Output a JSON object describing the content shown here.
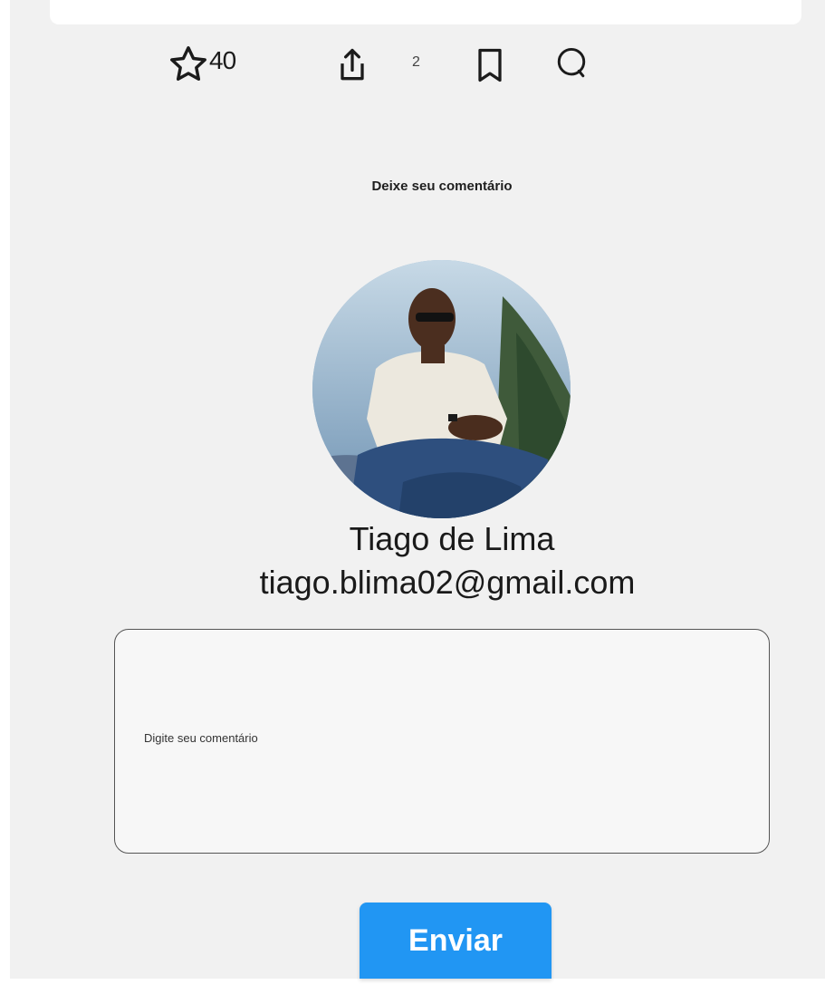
{
  "post_actions": {
    "star_count": "40",
    "share_count": "2"
  },
  "comment_section": {
    "title": "Deixe seu comentário",
    "placeholder": "Digite seu comentário",
    "submit_label": "Enviar"
  },
  "user": {
    "name": "Tiago de Lima",
    "email": "tiago.blima02@gmail.com"
  },
  "icons": {
    "star": "star-icon",
    "share": "share-icon",
    "bookmark": "bookmark-icon",
    "comment": "comment-icon"
  },
  "colors": {
    "page_background": "#f1f1f1",
    "card_background": "#ffffff",
    "button_background": "#2196f3",
    "button_text": "#ffffff"
  }
}
